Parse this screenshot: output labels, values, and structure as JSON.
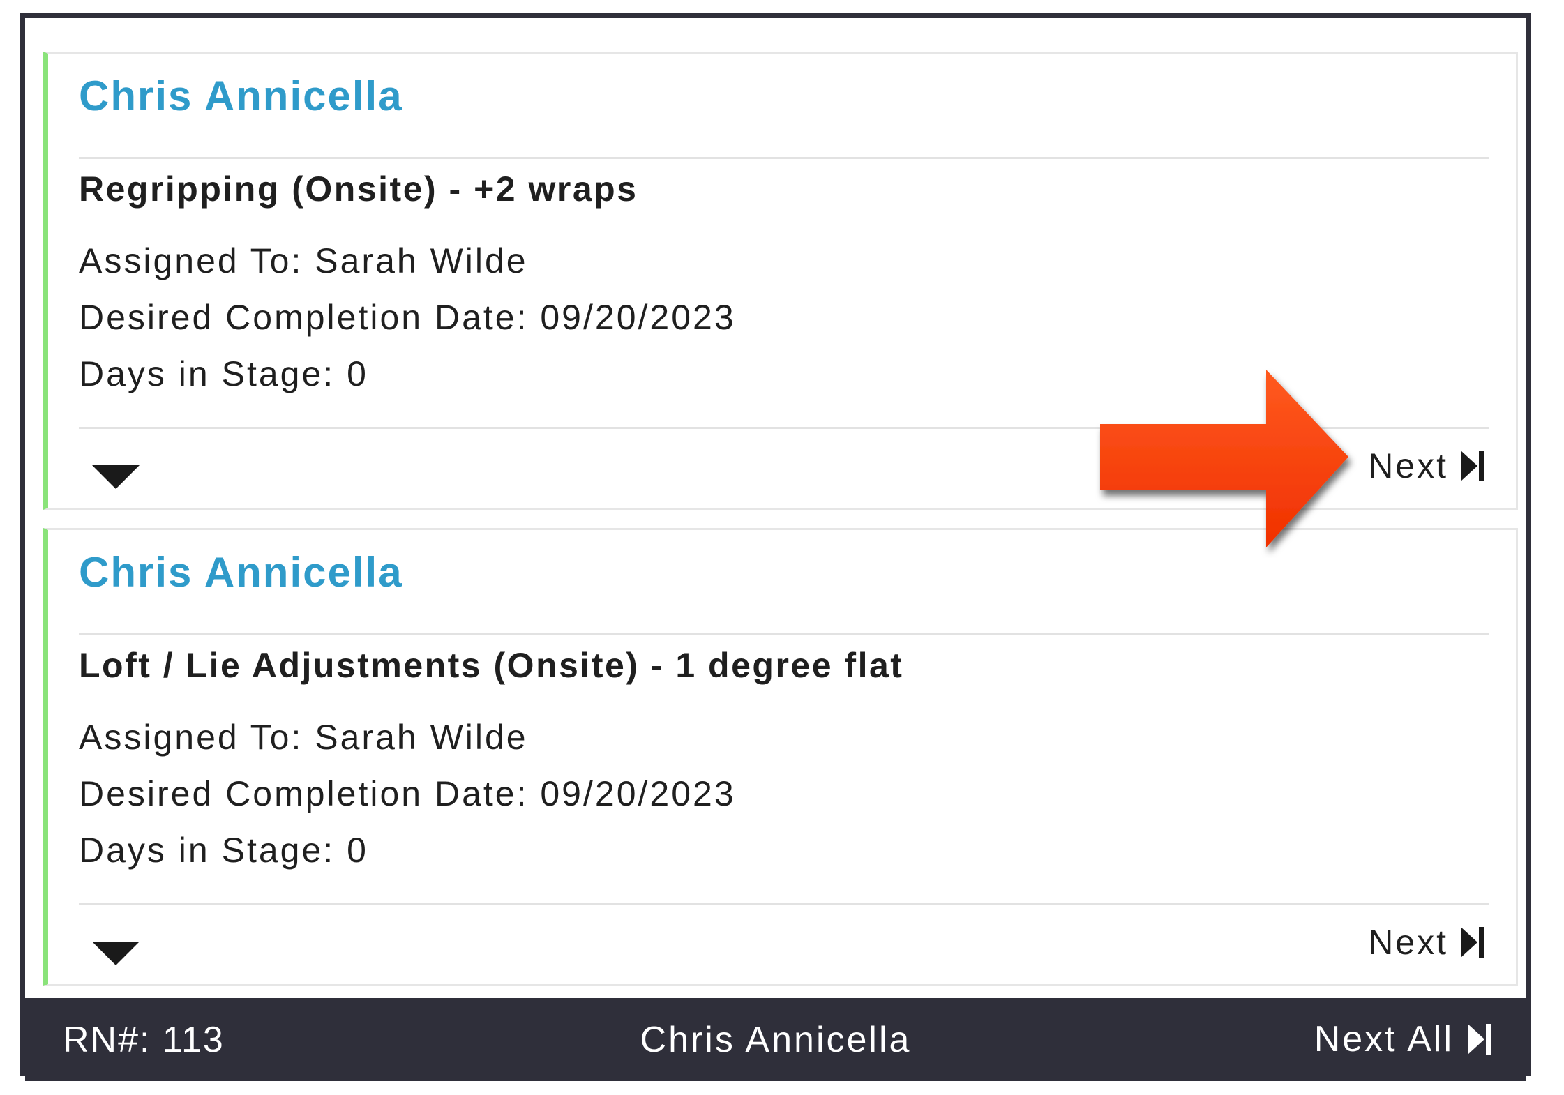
{
  "cards": [
    {
      "customer": "Chris Annicella",
      "service": "Regripping (Onsite) - +2 wraps",
      "assigned_to": "Assigned To: Sarah Wilde",
      "completion_date": "Desired Completion Date: 09/20/2023",
      "days_in_stage": "Days in Stage: 0",
      "next_label": "Next"
    },
    {
      "customer": "Chris Annicella",
      "service": "Loft / Lie Adjustments (Onsite) - 1 degree flat",
      "assigned_to": "Assigned To: Sarah Wilde",
      "completion_date": "Desired Completion Date: 09/20/2023",
      "days_in_stage": "Days in Stage: 0",
      "next_label": "Next"
    }
  ],
  "footer": {
    "rn": "RN#: 113",
    "customer": "Chris Annicella",
    "next_all_label": "Next All"
  },
  "colors": {
    "accent_name": "#2f9bca",
    "card_stripe": "#8ae37a",
    "footer_bg": "#2f2f3a",
    "annotation_arrow": "#ff3b0a"
  },
  "icons": {
    "expand": "triangle-down-icon",
    "next": "skip-forward-icon",
    "annotation": "red-arrow-icon"
  }
}
